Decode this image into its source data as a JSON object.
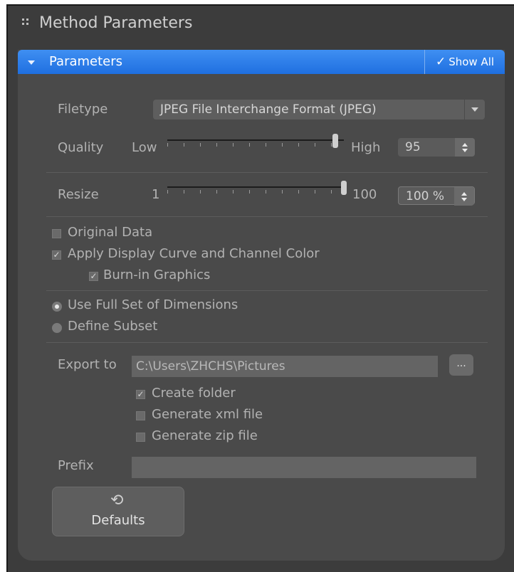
{
  "window": {
    "title": "Method Parameters"
  },
  "panel": {
    "title": "Parameters",
    "show_all_label": "Show All"
  },
  "filetype": {
    "label": "Filetype",
    "value": "JPEG File Interchange Format (JPEG)"
  },
  "quality": {
    "label": "Quality",
    "low_label": "Low",
    "high_label": "High",
    "value": "95",
    "position_fraction": 0.95
  },
  "resize": {
    "label": "Resize",
    "min_label": "1",
    "max_label": "100",
    "value": "100 %",
    "position_fraction": 1.0
  },
  "options": {
    "original_data": {
      "label": "Original Data",
      "checked": false
    },
    "apply_display_curve": {
      "label": "Apply Display Curve and Channel Color",
      "checked": true
    },
    "burn_in_graphics": {
      "label": "Burn-in Graphics",
      "checked": true
    }
  },
  "dimensions": {
    "full_set": {
      "label": "Use Full Set of Dimensions",
      "selected": true
    },
    "subset": {
      "label": "Define Subset",
      "selected": false
    }
  },
  "export": {
    "label": "Export to",
    "path": "C:\\Users\\ZHCHS\\Pictures",
    "browse_label": "...",
    "create_folder": {
      "label": "Create folder",
      "checked": true
    },
    "generate_xml": {
      "label": "Generate xml file",
      "checked": false
    },
    "generate_zip": {
      "label": "Generate zip file",
      "checked": false
    }
  },
  "prefix": {
    "label": "Prefix",
    "value": ""
  },
  "defaults_button": {
    "label": "Defaults"
  },
  "colors": {
    "accent": "#2a7de9",
    "background": "#3c3c3c",
    "panel": "#4a4a4a"
  }
}
